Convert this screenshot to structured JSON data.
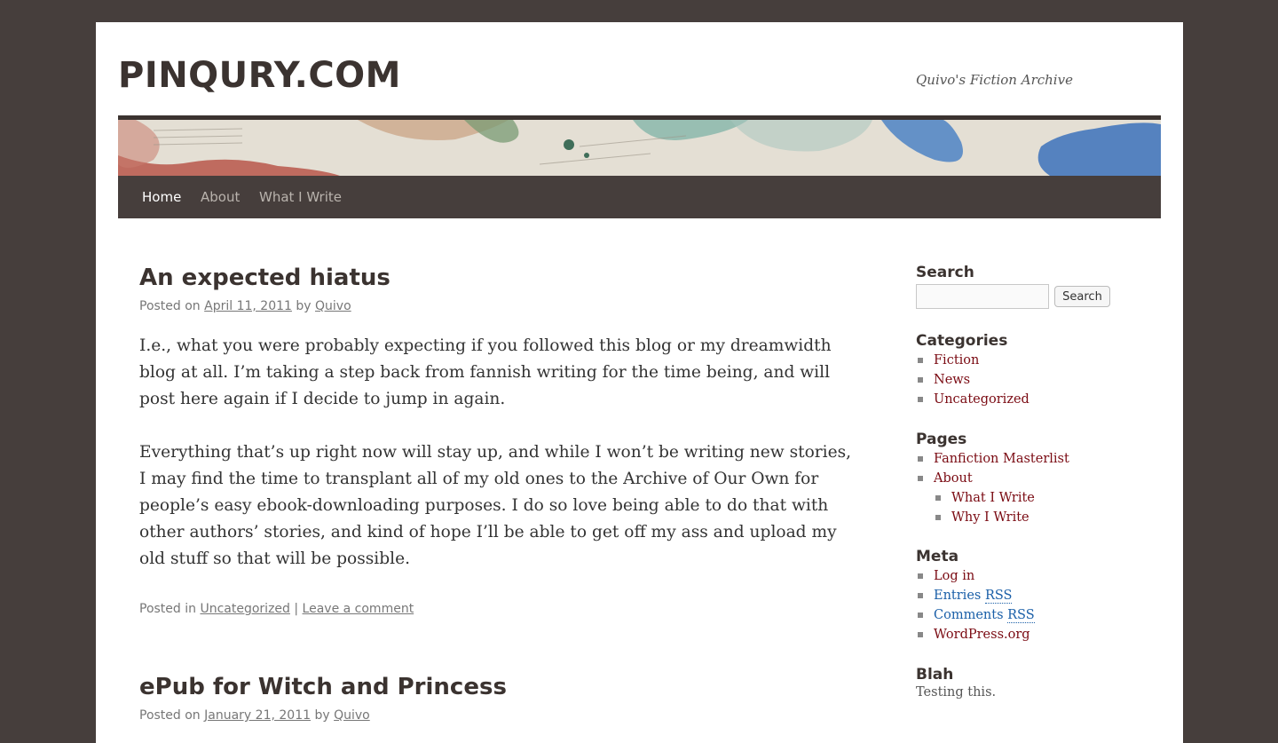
{
  "site": {
    "title": "PINQURY.COM",
    "description": "Quivo's Fiction Archive"
  },
  "nav": {
    "items": [
      "Home",
      "About",
      "What I Write"
    ],
    "current": "Home"
  },
  "posts": [
    {
      "title": "An expected hiatus",
      "posted_on_label": "Posted on",
      "date": "April 11, 2011",
      "by_label": "by",
      "author": "Quivo",
      "paragraphs": [
        "I.e., what you were probably expecting if you followed this blog or my dreamwidth blog at all. I’m taking a step back from fannish writing for the time being, and will post here again if I decide to jump in again.",
        "Everything that’s up right now will stay up, and while I won’t be writing new stories, I may find the time to transplant all of my old ones to the Archive of Our Own for people’s easy ebook-downloading purposes. I do so love being able to do that with other authors’ stories, and kind of hope I’ll be able to get off my ass and upload my old stuff so that will be possible."
      ],
      "posted_in_label": "Posted in",
      "category": "Uncategorized",
      "separator": "|",
      "comment_link": "Leave a comment"
    },
    {
      "title": "ePub for Witch and Princess",
      "posted_on_label": "Posted on",
      "date": "January 21, 2011",
      "by_label": "by",
      "author": "Quivo"
    }
  ],
  "sidebar": {
    "search": {
      "title": "Search",
      "input_value": "",
      "button_label": "Search"
    },
    "categories": {
      "title": "Categories",
      "items": [
        "Fiction",
        "News",
        "Uncategorized"
      ]
    },
    "pages": {
      "title": "Pages",
      "items": [
        "Fanfiction Masterlist",
        "About"
      ],
      "subitems": [
        "What I Write",
        "Why I Write"
      ]
    },
    "meta": {
      "title": "Meta",
      "login": "Log in",
      "entries": "Entries",
      "comments": "Comments",
      "rss": "RSS",
      "wordpress": "WordPress.org"
    },
    "blah": {
      "title": "Blah",
      "text": "Testing this."
    }
  },
  "colors": {
    "page_background": "#463e3c",
    "nav_background": "#463e3c",
    "link_color": "#7a0a12",
    "rss_link_color": "#1a5fa8",
    "title_color": "#3b3330"
  }
}
